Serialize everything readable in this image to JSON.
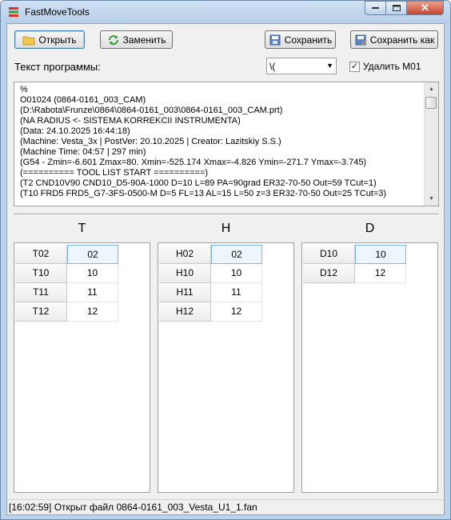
{
  "window": {
    "title": "FastMoveTools",
    "close_symbol": "✕"
  },
  "toolbar": {
    "open_label": "Открыть",
    "replace_label": "Заменить",
    "save_label": "Сохранить",
    "save_as_label": "Сохранить как"
  },
  "program": {
    "label": "Текст программы:",
    "comment_style_value": "\\(",
    "remove_m01_label": "Удалить M01",
    "remove_m01_checked": true,
    "lines": [
      "%",
      "O01024 (0864-0161_003_CAM)",
      "(D:\\Rabota\\Frunze\\0864\\0864-0161_003\\0864-0161_003_CAM.prt)",
      "(NA RADIUS <- SISTEMA KORREKCII INSTRUMENTA)",
      "(Data: 24.10.2025 16:44:18)",
      "(Machine: Vesta_3x | PostVer: 20.10.2025 | Creator: Lazitskiy S.S.)",
      "(Machine Time: 04:57 | 297 min)",
      "(G54 - Zmin=-6.601 Zmax=80. Xmin=-525.174 Xmax=-4.826 Ymin=-271.7 Ymax=-3.745)",
      "(========== TOOL LIST START ==========)",
      "(T2 CND10V90 CND10_D5-90A-1000 D=10 L=89 PA=90grad ER32-70-50 Out=59 TCut=1)",
      "(T10 FRD5 FRD5_G7-3FS-0500-M D=5 FL=13 AL=15 L=50 z=3 ER32-70-50 Out=25 TCut=3)"
    ]
  },
  "columns": {
    "t": {
      "header": "T",
      "rows": [
        {
          "key": "T02",
          "value": "02"
        },
        {
          "key": "T10",
          "value": "10"
        },
        {
          "key": "T11",
          "value": "11"
        },
        {
          "key": "T12",
          "value": "12"
        }
      ]
    },
    "h": {
      "header": "H",
      "rows": [
        {
          "key": "H02",
          "value": "02"
        },
        {
          "key": "H10",
          "value": "10"
        },
        {
          "key": "H11",
          "value": "11"
        },
        {
          "key": "H12",
          "value": "12"
        }
      ]
    },
    "d": {
      "header": "D",
      "rows": [
        {
          "key": "D10",
          "value": "10"
        },
        {
          "key": "D12",
          "value": "12"
        }
      ]
    }
  },
  "status": {
    "text": "[16:02:59] Открыт файл 0864-0161_003_Vesta_U1_1.fan"
  },
  "colors": {
    "accent": "#3c7fb1",
    "selection": "#7eb4ea",
    "titlebar": "#bcd3ec",
    "close": "#c8442c"
  },
  "icons": {
    "app": "tools-icon",
    "open": "folder-icon",
    "replace": "refresh-icon",
    "save": "floppy-disk-icon",
    "save_as": "floppy-disk-pencil-icon"
  }
}
